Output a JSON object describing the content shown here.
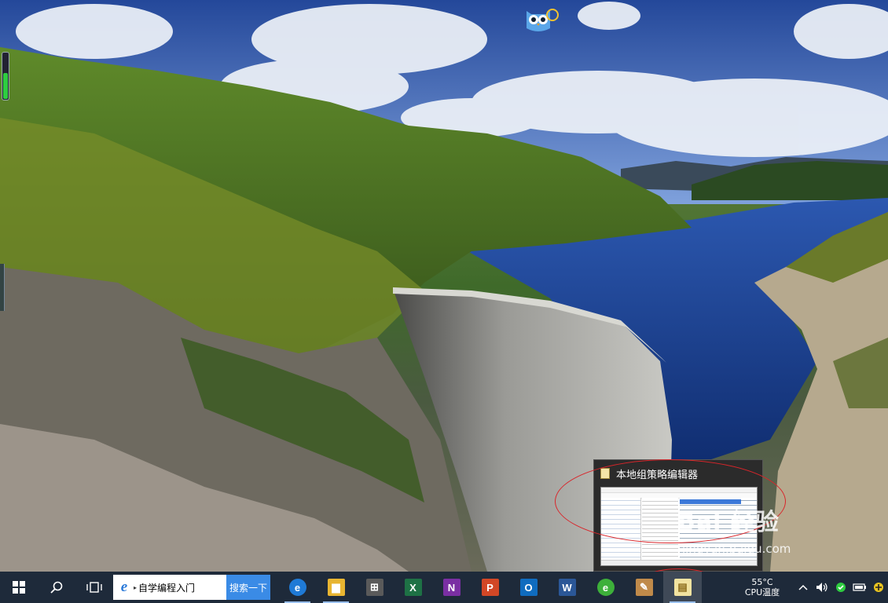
{
  "desktop": {
    "description_colors": {
      "sky": "#3b5fa8",
      "cloud": "#e6ecf5",
      "forest": "#3e6a22",
      "water": "#1f3f8c",
      "dam": "#8a8a86",
      "rock": "#9a8a70"
    },
    "widget_gauge_level": 0.55
  },
  "taskbar_preview": {
    "title": "本地组策略编辑器"
  },
  "watermark": {
    "logo": "Bai 经验",
    "url": "jingyan.baidu.com"
  },
  "taskbar": {
    "search": {
      "text": "自学编程入门",
      "button": "搜索一下"
    },
    "apps": [
      {
        "name": "edge",
        "glyph": "e",
        "color": "#1f7ad6"
      },
      {
        "name": "file-explorer",
        "glyph": "▆",
        "color": "#e8b531"
      },
      {
        "name": "store",
        "glyph": "⊞",
        "color": "#5a5a5a"
      },
      {
        "name": "excel",
        "glyph": "X",
        "color": "#1e7145"
      },
      {
        "name": "onenote",
        "glyph": "N",
        "color": "#7a2fa3"
      },
      {
        "name": "powerpoint",
        "glyph": "P",
        "color": "#d24726"
      },
      {
        "name": "outlook",
        "glyph": "O",
        "color": "#0f6cbf"
      },
      {
        "name": "word",
        "glyph": "W",
        "color": "#2b5797"
      },
      {
        "name": "360",
        "glyph": "e",
        "color": "#3db03a"
      },
      {
        "name": "paint",
        "glyph": "✎",
        "color": "#c08a4a"
      },
      {
        "name": "group-policy-editor",
        "glyph": "▤",
        "color": "#f2e3a0"
      }
    ],
    "cpu_temp": "55°C",
    "cpu_label": "CPU温度",
    "accent": "#1e2a3a"
  }
}
